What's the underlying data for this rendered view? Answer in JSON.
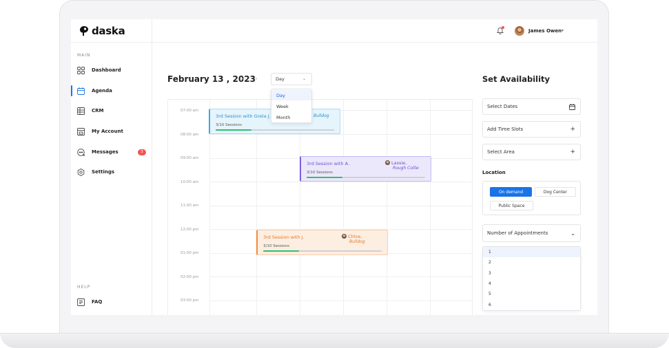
{
  "app": {
    "logo_text": "daska"
  },
  "sidebar": {
    "main_label": "MAIN",
    "help_label": "HELP",
    "items": [
      {
        "label": "Dashboard",
        "icon": "grid-icon"
      },
      {
        "label": "Agenda",
        "icon": "calendar-icon",
        "active": true
      },
      {
        "label": "CRM",
        "icon": "table-icon"
      },
      {
        "label": "My Account",
        "icon": "account-icon"
      },
      {
        "label": "Messages",
        "icon": "message-icon",
        "badge": "3"
      },
      {
        "label": "Settings",
        "icon": "gear-icon"
      }
    ],
    "help_items": [
      {
        "label": "FAQ",
        "icon": "faq-icon"
      }
    ]
  },
  "header": {
    "user_name": "James Owen",
    "caret": "▾",
    "notification": true
  },
  "calendar": {
    "date_title": "February 13 , 2023",
    "prev": "‹",
    "next": "›",
    "view_select": {
      "value": "Day",
      "options": [
        "Day",
        "Week",
        "Month"
      ],
      "selected": "Day"
    },
    "time_slots": [
      "07:00 am",
      "08:00 am",
      "09:00 am",
      "10:00 am",
      "11:00 am",
      "12:00 pm",
      "01:00 pm",
      "02:00 pm",
      "03:00 pm"
    ],
    "events": [
      {
        "title": "3rd Session with Greta J.",
        "sessions": "3/10 Sessions",
        "progress": 0.3,
        "pet_breed": "Bulldog",
        "accent": "#38a8e6",
        "bg": "#e6f4fc",
        "title_color": "#2a8fd0"
      },
      {
        "title": "3rd Session with A.",
        "sessions": "3/10 Sessions",
        "progress": 0.3,
        "pet_name": "Lassie,",
        "pet_breed": "Rough Collie",
        "accent": "#7c5ce0",
        "bg": "#ece8fb",
        "title_color": "#6a4fd6"
      },
      {
        "title": "3rd Session with J.",
        "sessions": "3/10 Sessions",
        "progress": 0.3,
        "pet_name": "Chloe,",
        "pet_breed": "Bulldog",
        "accent": "#f08a3c",
        "bg": "#fdeee2",
        "title_color": "#e07b2a"
      }
    ],
    "progress_color": "#2fbf71"
  },
  "availability": {
    "title": "Set Availability",
    "select_dates": "Select Dates",
    "add_time_slots": "Add Time Slots",
    "select_area": "Select Area",
    "location_label": "Location",
    "location_options": [
      "On demand",
      "Dog Center",
      "Public Space"
    ],
    "location_selected": "On demand",
    "appointments_label": "Number of Appointments",
    "appointment_options": [
      "1",
      "2",
      "3",
      "4",
      "5",
      "6"
    ],
    "appointment_selected": "1",
    "accent": "#1a73e8"
  }
}
